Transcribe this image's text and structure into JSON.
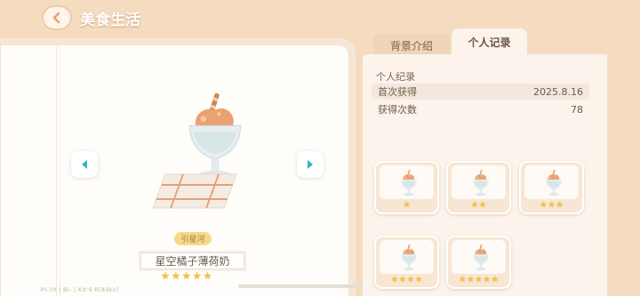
{
  "header": {
    "back_icon": "chevron-left-icon",
    "title": "美食生活"
  },
  "tabs": [
    {
      "label": "背景介绍",
      "active": false
    },
    {
      "label": "个人记录",
      "active": true
    }
  ],
  "item": {
    "tag": "引星河",
    "name": "星空橘子薄荷奶",
    "stars": 5
  },
  "footer_text": "PI-30  |  BI-  |  Kit·S·R[83kx]",
  "record": {
    "section_title": "个人纪录",
    "first_obtained_label": "首次获得",
    "first_obtained_value": "2025.8.16",
    "count_label": "获得次数",
    "count_value": "78"
  },
  "variants": [
    {
      "stars": 1
    },
    {
      "stars": 2
    },
    {
      "stars": 3
    },
    {
      "stars": 4
    },
    {
      "stars": 5
    }
  ],
  "colors": {
    "background": "#f5dcc0",
    "star": "#f5c442",
    "arrow": "#3bb0c9",
    "accent_orange": "#e9a070"
  }
}
